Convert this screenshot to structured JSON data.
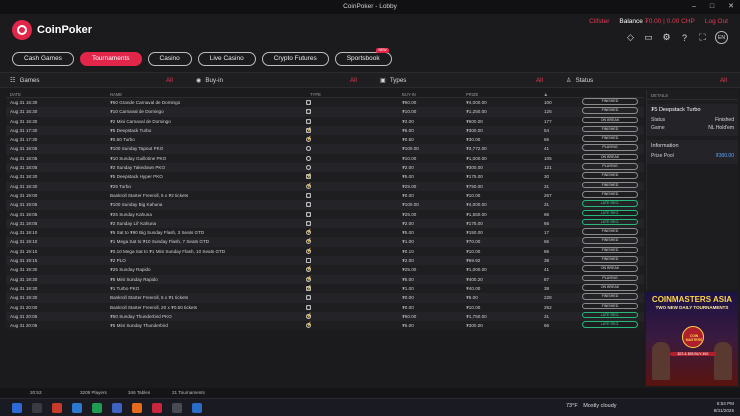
{
  "window": {
    "title": "CoinPoker - Lobby",
    "minimize": "–",
    "maximize": "□",
    "close": "✕"
  },
  "brand": {
    "name": "CoinPoker"
  },
  "user": {
    "name": "Clifster",
    "balance_label": "Balance",
    "balance_value": "₮0.00",
    "separator": "|",
    "chp": "0.00 CHP",
    "logout": "Log Out"
  },
  "header_icons": [
    "diamond-icon",
    "wallet-icon",
    "settings-icon",
    "help-icon",
    "fullscreen-icon"
  ],
  "lang": "EN",
  "tabs": [
    {
      "label": "Cash Games",
      "active": false
    },
    {
      "label": "Tournaments",
      "active": true
    },
    {
      "label": "Casino",
      "active": false
    },
    {
      "label": "Live Casino",
      "active": false
    },
    {
      "label": "Crypto Futures",
      "active": false
    },
    {
      "label": "Sportsbook",
      "active": false,
      "badge": "NEW"
    }
  ],
  "filters": {
    "games": {
      "label": "Games",
      "value": "All"
    },
    "buyin": {
      "label": "Buy-in",
      "value": "All"
    },
    "types": {
      "label": "Types",
      "value": "All"
    },
    "status": {
      "label": "Status",
      "value": "All"
    }
  },
  "table": {
    "headers": {
      "date": "DATE",
      "name": "NAME",
      "type": "TYPE",
      "buyin": "BUY-IN",
      "prize": "PRIZE",
      "players": ""
    },
    "rows": [
      {
        "date": "Aug 31 16:30",
        "name": "₮50 Grande Carnaval de Domingo",
        "buyin": "₮50.00",
        "prize": "₮4,000.00",
        "players": "100",
        "status": "FINISHED",
        "icons": [
          "circle",
          "sq"
        ]
      },
      {
        "date": "Aug 31 16:30",
        "name": "₮10 Carnaval de Domingo",
        "buyin": "₮10.00",
        "prize": "₮1,250.00",
        "players": "125",
        "status": "FINISHED",
        "icons": [
          "circle",
          "sq"
        ]
      },
      {
        "date": "Aug 31 16:30",
        "name": "₮2 Mini Carnaval de Domingo",
        "buyin": "₮2.00",
        "prize": "₮500.00",
        "players": "177",
        "status": "ON BREAK",
        "icons": [
          "circle",
          "sq"
        ]
      },
      {
        "date": "Aug 31 17:30",
        "name": "₮5 Deepstack Turbo",
        "buyin": "₮5.00",
        "prize": "₮300.00",
        "players": "54",
        "status": "FINISHED",
        "icons": [
          "bolt",
          "circle",
          "sq"
        ]
      },
      {
        "date": "Aug 31 17:30",
        "name": "₮0.50 Turbo",
        "buyin": "₮0.50",
        "prize": "₮30.00",
        "players": "65",
        "status": "FINISHED",
        "icons": [
          "bolt",
          "circle"
        ]
      },
      {
        "date": "Aug 31 18:05",
        "name": "₮100 Sunday Tapout PKO",
        "buyin": "₮100.00",
        "prize": "₮3,772.00",
        "players": "41",
        "status": "PLAYING",
        "icons": [
          "circle",
          "circle"
        ]
      },
      {
        "date": "Aug 31 18:05",
        "name": "₮10 Sunday Guillotine PKO",
        "buyin": "₮10.00",
        "prize": "₮1,000.00",
        "players": "105",
        "status": "ON BREAK",
        "icons": [
          "circle",
          "circle"
        ]
      },
      {
        "date": "Aug 31 18:05",
        "name": "₮2 Sunday Takedown PKO",
        "buyin": "₮2.00",
        "prize": "₮300.00",
        "players": "121",
        "status": "PLAYING",
        "icons": [
          "circle",
          "circle"
        ]
      },
      {
        "date": "Aug 31 18:30",
        "name": "₮5 Deepstack Hyper PKO",
        "buyin": "₮5.00",
        "prize": "₮175.00",
        "players": "30",
        "status": "FINISHED",
        "icons": [
          "bolt",
          "circle",
          "circle",
          "sq"
        ]
      },
      {
        "date": "Aug 31 18:30",
        "name": "₮25 Turbo",
        "buyin": "₮25.00",
        "prize": "₮750.00",
        "players": "31",
        "status": "FINISHED",
        "icons": [
          "bolt",
          "circle"
        ]
      },
      {
        "date": "Aug 31 19:00",
        "name": "Bankroll Starter Freeroll, 5 x ₮2 tickets",
        "buyin": "₮0.00",
        "prize": "₮10.00",
        "players": "267",
        "status": "FINISHED",
        "icons": [
          "circle",
          "sq"
        ]
      },
      {
        "date": "Aug 31 19:05",
        "name": "₮100 Sunday Big Kahuna",
        "buyin": "₮100.00",
        "prize": "₮4,000.00",
        "players": "31",
        "status": "LATE REG.",
        "icons": [
          "circle",
          "sq"
        ]
      },
      {
        "date": "Aug 31 19:05",
        "name": "₮25 Sunday Kahuna",
        "buyin": "₮25.00",
        "prize": "₮1,550.00",
        "players": "66",
        "status": "LATE REG.",
        "icons": [
          "circle",
          "sq"
        ]
      },
      {
        "date": "Aug 31 19:05",
        "name": "₮2 Sunday Lil' Kahuna",
        "buyin": "₮2.00",
        "prize": "₮175.00",
        "players": "66",
        "status": "LATE REG.",
        "icons": [
          "circle",
          "sq"
        ]
      },
      {
        "date": "Aug 31 19:10",
        "name": "₮5 Sat to ₮90 Big Sunday Flash, 3 Seats GTD",
        "buyin": "₮5.00",
        "prize": "₮150.00",
        "players": "17",
        "status": "FINISHED",
        "icons": [
          "bolt",
          "circle"
        ]
      },
      {
        "date": "Aug 31 19:10",
        "name": "₮1 Mega Sat to ₮10 Sunday Flash, 7 Seats GTD",
        "buyin": "₮1.00",
        "prize": "₮70.00",
        "players": "65",
        "status": "FINISHED",
        "icons": [
          "bolt",
          "circle"
        ]
      },
      {
        "date": "Aug 31 19:10",
        "name": "₮0.10 Mega Sat to ₮1 Mini Sunday Flash, 10 Seats GTD",
        "buyin": "₮0.10",
        "prize": "₮10.00",
        "players": "86",
        "status": "FINISHED",
        "icons": [
          "bolt",
          "circle"
        ]
      },
      {
        "date": "Aug 31 19:15",
        "name": "₮2 PLO",
        "buyin": "₮2.00",
        "prize": "₮69.92",
        "players": "38",
        "status": "FINISHED",
        "icons": [
          "sq",
          "sq"
        ]
      },
      {
        "date": "Aug 31 19:30",
        "name": "₮25 Sunday Rapido",
        "buyin": "₮25.00",
        "prize": "₮1,000.00",
        "players": "41",
        "status": "ON BREAK",
        "icons": [
          "bolt",
          "circle",
          "circle"
        ]
      },
      {
        "date": "Aug 31 19:30",
        "name": "₮5 Mini Sunday Rapido",
        "buyin": "₮5.00",
        "prize": "₮400.20",
        "players": "87",
        "status": "PLAYING",
        "icons": [
          "bolt",
          "circle",
          "circle"
        ]
      },
      {
        "date": "Aug 31 19:30",
        "name": "₮1 Turbo PKO",
        "buyin": "₮1.00",
        "prize": "₮40.00",
        "players": "38",
        "status": "ON BREAK",
        "icons": [
          "bolt",
          "circle",
          "circle",
          "sq"
        ]
      },
      {
        "date": "Aug 31 19:30",
        "name": "Bankroll Starter Freeroll, 5 x ₮1 tickets",
        "buyin": "₮0.00",
        "prize": "₮5.00",
        "players": "228",
        "status": "FINISHED",
        "icons": [
          "circle",
          "sq"
        ]
      },
      {
        "date": "Aug 31 20:00",
        "name": "Bankroll Starter Freeroll, 20 x ₮0.50 tickets",
        "buyin": "₮0.00",
        "prize": "₮10.00",
        "players": "252",
        "status": "FINISHED",
        "icons": [
          "circle",
          "sq"
        ]
      },
      {
        "date": "Aug 31 20:05",
        "name": "₮50 Sunday Thunderbird PKO",
        "buyin": "₮50.00",
        "prize": "₮1,750.00",
        "players": "31",
        "status": "LATE REG.",
        "icons": [
          "bolt",
          "circle",
          "circle"
        ]
      },
      {
        "date": "Aug 31 20:05",
        "name": "₮5 Mini Sunday Thunderbird",
        "buyin": "₮5.00",
        "prize": "₮300.00",
        "players": "66",
        "status": "LATE REG.",
        "icons": [
          "bolt",
          "circle"
        ]
      }
    ]
  },
  "details": {
    "header": "DETAILS",
    "title": "₮5 Deepstack Turbo",
    "status_label": "Status",
    "status_value": "Finished",
    "game_label": "Game",
    "game_value": "NL Hold'em",
    "info_header": "Information",
    "prize_label": "Prize Pool",
    "prize_value": "₮300.00"
  },
  "ad": {
    "title": "COINMASTERS ASIA",
    "subtitle": "TWO NEW DAILY TOURNAMENTS",
    "badge": "COIN MASTERS",
    "cta": "$23 & $55 BUY-INS"
  },
  "statusbar": {
    "time": "20:53",
    "players": "3209 Players",
    "tables": "346 Tables",
    "tournaments": "21 Tournaments"
  },
  "taskbar": {
    "weather_temp": "73°F",
    "weather_desc": "Mostly cloudy",
    "clock": "8:53 PM",
    "date": "8/31/2025"
  }
}
